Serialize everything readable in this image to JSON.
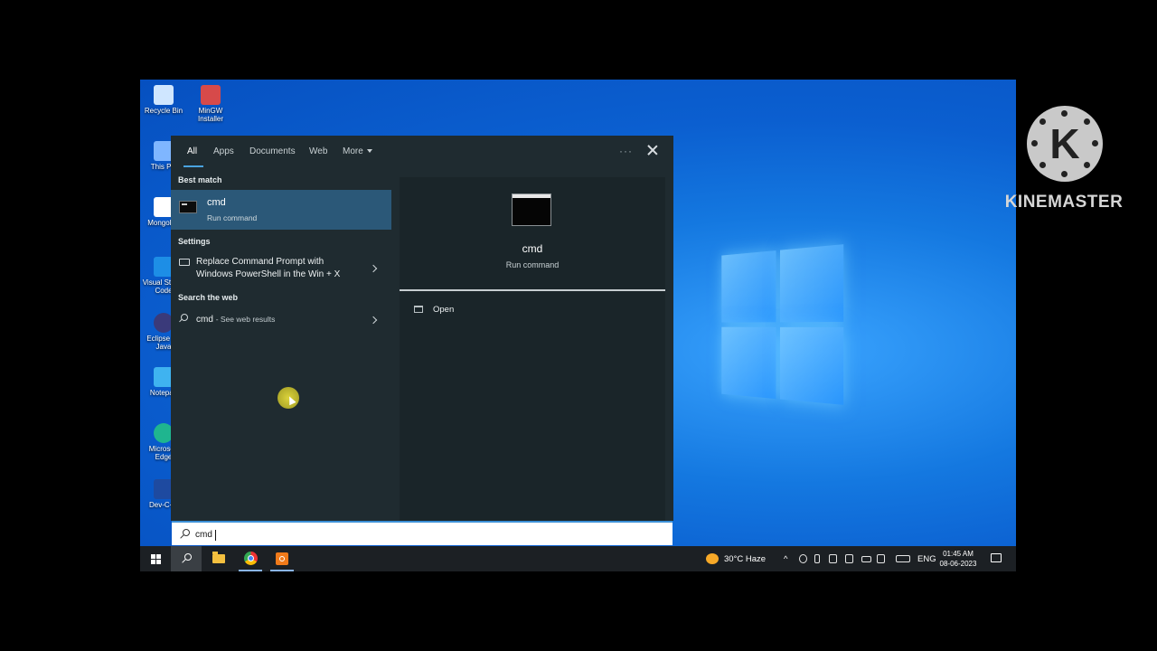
{
  "desktop": {
    "icons": [
      {
        "label": "Recycle Bin",
        "color": "#cfe6ff"
      },
      {
        "label": "MinGW Installer",
        "color": "#d64a4a"
      },
      {
        "label": "This PC",
        "color": "#7fb6ff"
      },
      {
        "label": "MongoDB",
        "color": "#ffffff"
      },
      {
        "label": "Visual Studio Code",
        "color": "#1d8ee6"
      },
      {
        "label": "Eclipse for Java",
        "color": "#3a3a7a"
      },
      {
        "label": "Notepad",
        "color": "#3fb3f0"
      },
      {
        "label": "Microsoft Edge",
        "color": "#1fb58f"
      },
      {
        "label": "Dev-C++",
        "color": "#1e4aa0"
      }
    ]
  },
  "start_menu": {
    "tabs": [
      "All",
      "Apps",
      "Documents",
      "Web",
      "More"
    ],
    "active_tab": "All",
    "sections": {
      "best_match": "Best match",
      "settings": "Settings",
      "search_web": "Search the web"
    },
    "best_match": {
      "title": "cmd",
      "subtitle": "Run command"
    },
    "settings_item": {
      "line1": "Replace Command Prompt with",
      "line2": "Windows PowerShell in the Win + X"
    },
    "web_item": {
      "query": "cmd",
      "suffix": "- See web results"
    },
    "preview": {
      "title": "cmd",
      "subtitle": "Run command",
      "action_open": "Open"
    },
    "more_options": "···"
  },
  "search": {
    "value": "cmd",
    "placeholder": ""
  },
  "taskbar": {
    "weather": "30°C  Haze",
    "language": "ENG",
    "time": "01:45 AM",
    "date": "08-06-2023"
  },
  "watermark": {
    "text": "KINEMASTER",
    "logo_letter": "K"
  },
  "colors": {
    "accent": "#4aa3df",
    "selection": "#2b5878",
    "menu_bg": "#1f2b30"
  }
}
